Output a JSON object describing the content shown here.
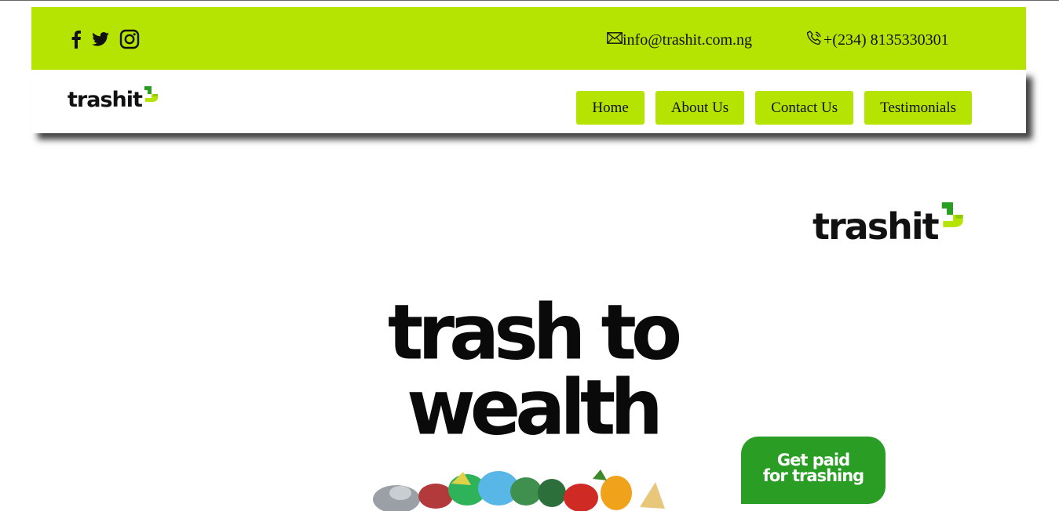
{
  "topbar": {
    "social": [
      {
        "name": "facebook-icon"
      },
      {
        "name": "twitter-icon"
      },
      {
        "name": "instagram-icon"
      }
    ],
    "email": "info@trashit.com.ng",
    "phone": "+(234) 8135330301",
    "background": "#b5e302"
  },
  "header": {
    "logo_text": "trashit",
    "nav": {
      "home": "Home",
      "about": "About Us",
      "contact": "Contact Us",
      "testimonials": "Testimonials"
    }
  },
  "hero": {
    "logo_text": "trashit",
    "title_line1": "trash to",
    "title_line2": "wealth",
    "cta_line1": "Get paid",
    "cta_line2": "for trashing",
    "cta_color": "#2a9d24"
  },
  "colors": {
    "accent": "#b5e302",
    "logo_green": "#2a9d24"
  }
}
